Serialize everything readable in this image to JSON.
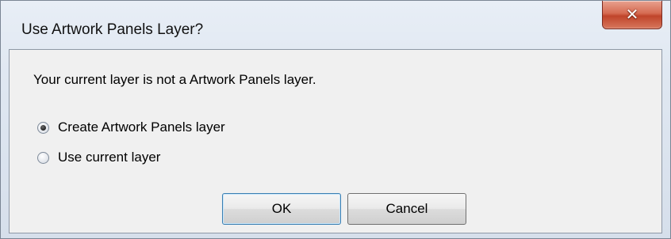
{
  "dialog": {
    "title": "Use Artwork Panels Layer?",
    "close_icon": "close-icon",
    "message": "Your current layer is not a Artwork Panels layer.",
    "options": [
      {
        "label": "Create Artwork Panels layer",
        "selected": true
      },
      {
        "label": "Use current layer",
        "selected": false
      }
    ],
    "buttons": {
      "ok": "OK",
      "cancel": "Cancel"
    },
    "colors": {
      "close_button": "#c0442a",
      "default_button_border": "#3c7fb1",
      "client_background": "#f0f0f0"
    }
  }
}
